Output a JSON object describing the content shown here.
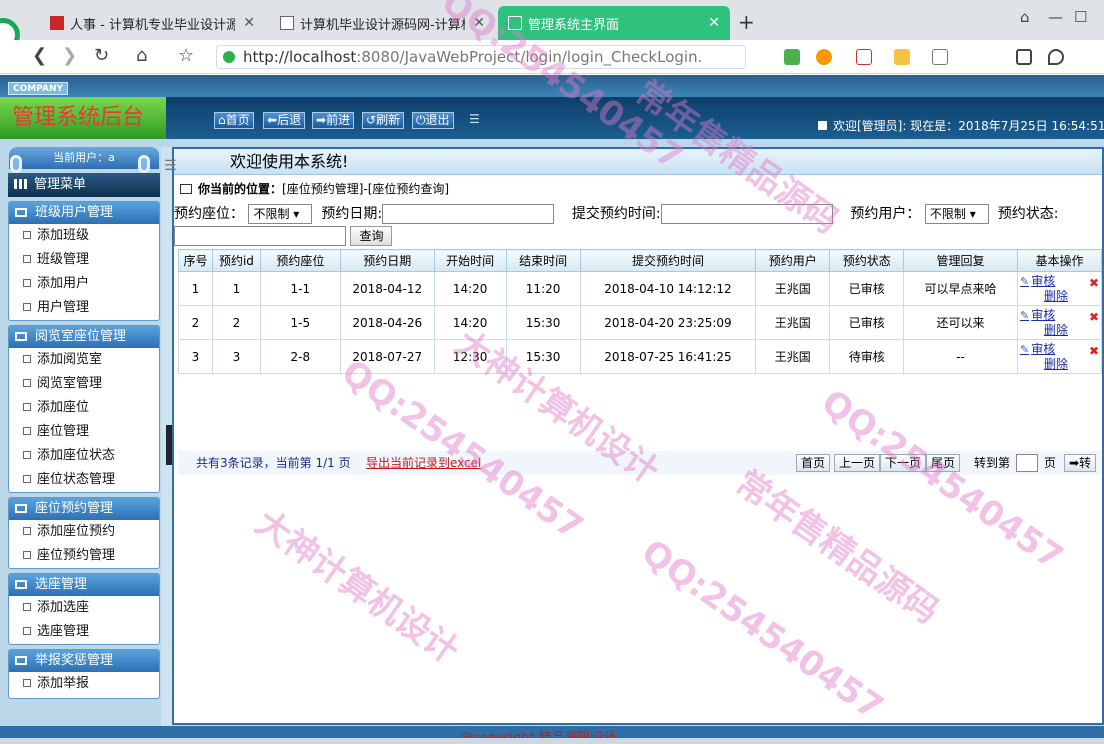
{
  "browser": {
    "tabs": [
      {
        "title": "人事 - 计算机专业毕业设计源码"
      },
      {
        "title": "计算机毕业设计源码网-计算机毕"
      },
      {
        "title": "管理系统主界面"
      }
    ],
    "new_tab": "+",
    "url_host": "http://localhost",
    "url_rest": ":8080/JavaWebProject/login/login_CheckLogin."
  },
  "app": {
    "company": "COMPANY",
    "logo_text": "管理系统后台",
    "toolbar": {
      "home": "首页",
      "back": "后退",
      "forward": "前进",
      "refresh": "刷新",
      "logout": "退出"
    },
    "welcome": "欢迎[管理员]:  现在是：2018年7月25日 16:54:51"
  },
  "sidebar": {
    "current_user": "当前用户：a",
    "main_menu": "管理菜单",
    "groups": [
      {
        "title": "班级用户管理",
        "items": [
          "添加班级",
          "班级管理",
          "添加用户",
          "用户管理"
        ]
      },
      {
        "title": "阅览室座位管理",
        "items": [
          "添加阅览室",
          "阅览室管理",
          "添加座位",
          "座位管理",
          "添加座位状态",
          "座位状态管理"
        ]
      },
      {
        "title": "座位预约管理",
        "items": [
          "添加座位预约",
          "座位预约管理"
        ]
      },
      {
        "title": "选座管理",
        "items": [
          "添加选座",
          "选座管理"
        ]
      },
      {
        "title": "举报奖惩管理",
        "items": [
          "添加举报"
        ]
      }
    ]
  },
  "main": {
    "welcome_title": "欢迎使用本系统!",
    "location_label": "你当前的位置：",
    "location_path": "[座位预约管理]-[座位预约查询]",
    "search": {
      "seat_label": "预约座位：",
      "seat_value": "不限制 ▾",
      "date_label": "预约日期:",
      "submit_time_label": "提交预约时间:",
      "user_label": "预约用户：",
      "user_value": "不限制 ▾",
      "status_label": "预约状态:",
      "query_button": "查询"
    },
    "table": {
      "headers": [
        "序号",
        "预约id",
        "预约座位",
        "预约日期",
        "开始时间",
        "结束时间",
        "提交预约时间",
        "预约用户",
        "预约状态",
        "管理回复",
        "基本操作"
      ],
      "rows": [
        [
          "1",
          "1",
          "1-1",
          "2018-04-12",
          "14:20",
          "11:20",
          "2018-04-10 14:12:12",
          "王兆国",
          "已审核",
          "可以早点来哈"
        ],
        [
          "2",
          "2",
          "1-5",
          "2018-04-26",
          "14:20",
          "15:30",
          "2018-04-20 23:25:09",
          "王兆国",
          "已审核",
          "还可以来"
        ],
        [
          "3",
          "3",
          "2-8",
          "2018-07-27",
          "12:30",
          "15:30",
          "2018-07-25 16:41:25",
          "王兆国",
          "待审核",
          "--"
        ]
      ],
      "op_review": "审核",
      "op_delete": "删除"
    },
    "pager": {
      "summary": "共有3条记录，当前第 1/1 页",
      "export": "导出当前记录到excel",
      "first": "首页",
      "prev": "上一页",
      "next": "下一页",
      "last": "尾页",
      "goto_label": "转到第",
      "page_unit": "页",
      "go": "➡转"
    }
  },
  "footer": {
    "copyright": "@copyright 精品源码设计"
  },
  "watermarks": [
    "QQ:254540457",
    "大神计算机设计",
    "常年售精品源码"
  ]
}
